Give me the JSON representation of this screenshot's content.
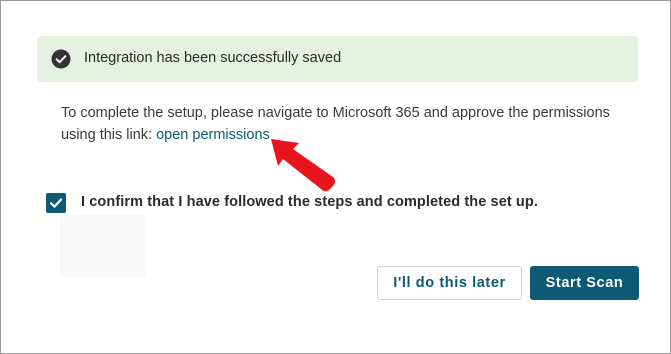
{
  "alert": {
    "icon": "check-circle-icon",
    "message": "Integration has been successfully saved",
    "background": "#e3f3df"
  },
  "instructions": {
    "text": "To complete the setup, please navigate to Microsoft 365 and approve the permissions using this link: ",
    "link_label": "open permissions"
  },
  "annotation": {
    "icon": "red-arrow-icon",
    "color": "#e8161c"
  },
  "confirmation": {
    "checked": true,
    "label": "I confirm that I have followed the steps and completed the set up."
  },
  "actions": {
    "later_label": "I'll do this later",
    "scan_label": "Start Scan"
  },
  "colors": {
    "accent": "#0c5a73"
  }
}
